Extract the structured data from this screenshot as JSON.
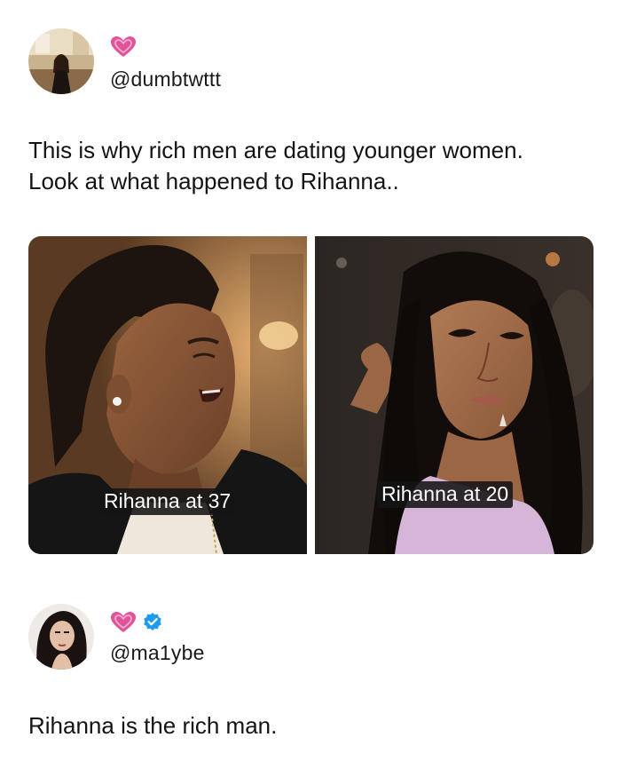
{
  "posts": [
    {
      "handle": "@dumbtwttt",
      "badges": [
        "pink-heart-icon"
      ],
      "text_lines": [
        "This is why rich men are dating younger women.",
        "Look at what happened to Rihanna.."
      ],
      "images": [
        {
          "icon": "photo-woman-smiling",
          "caption": "Rihanna at 37"
        },
        {
          "icon": "photo-woman-long-hair",
          "caption": "Rihanna at 20"
        }
      ]
    },
    {
      "handle": "@ma1ybe",
      "badges": [
        "pink-heart-icon",
        "verified-badge-icon"
      ],
      "text_lines": [
        "Rihanna is the rich man."
      ]
    }
  ],
  "colors": {
    "heart": "#e0549a",
    "verified": "#1d9bf0",
    "caption_bg": "#141414",
    "text": "#141414"
  }
}
